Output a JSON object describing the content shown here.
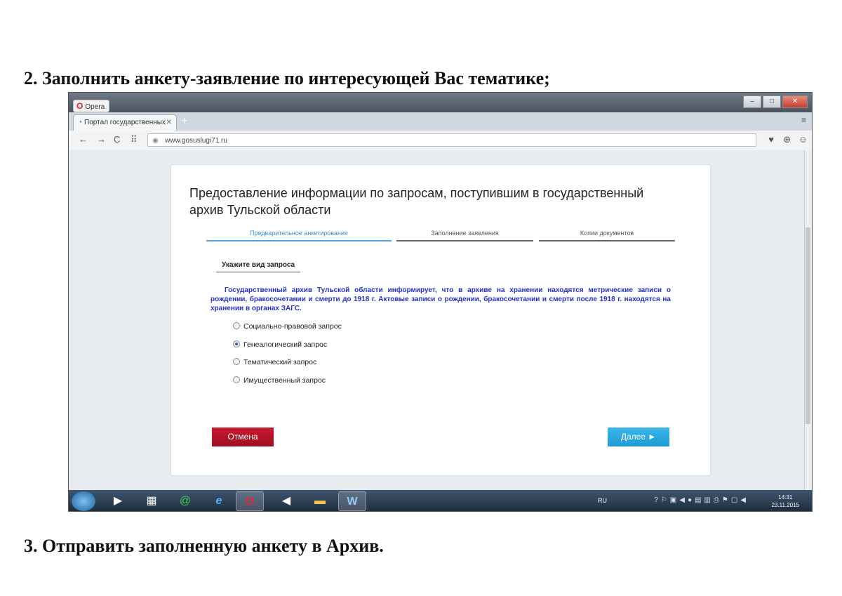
{
  "doc": {
    "step2": "2.  Заполнить анкету-заявление по интересующей Вас тематике;",
    "step3": "3. Отправить заполненную анкету в  Архив."
  },
  "browser": {
    "app_label": "Opera",
    "tab_title": "Портал государственных",
    "url": "www.gosuslugi71.ru"
  },
  "form": {
    "title": "Предоставление информации по запросам, поступившим в государственный архив Тульской области",
    "steps": [
      {
        "label": "Предварительное анкетирование"
      },
      {
        "label": "Заполнение заявления"
      },
      {
        "label": "Копии документов"
      }
    ],
    "section_label": "Укажите вид запроса",
    "info_text": "Государственный архив Тульской области информирует, что в архиве на хранении находятся метрические записи о рождении, бракосочетании и смерти до 1918 г. Актовые записи о рождении, бракосочетании и смерти после 1918 г. находятся на хранении в органах ЗАГС.",
    "options": [
      {
        "label": "Социально-правовой запрос",
        "checked": false
      },
      {
        "label": "Генеалогический запрос",
        "checked": true
      },
      {
        "label": "Тематический запрос",
        "checked": false
      },
      {
        "label": "Имущественный запрос",
        "checked": false
      }
    ],
    "cancel_label": "Отмена",
    "next_label": "Далее ►"
  },
  "taskbar": {
    "lang": "RU",
    "time": "14:31",
    "date": "23.11.2015"
  }
}
